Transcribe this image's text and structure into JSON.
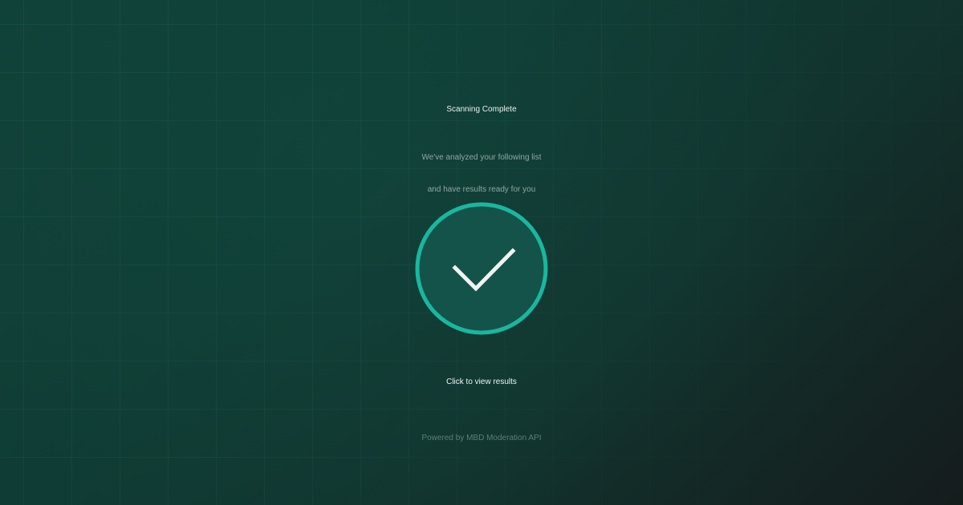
{
  "status": {
    "title": "Scanning Complete",
    "subtitle_line1": "We've analyzed your following list",
    "subtitle_line2": "and have results ready for you",
    "cta": "Click to view results",
    "footer": "Powered by MBD Moderation API"
  },
  "badge": {
    "icon": "checkmark-icon",
    "ring_color": "#1ab7a0",
    "fill_color": "#145349",
    "check_color": "#f2f2f2"
  }
}
